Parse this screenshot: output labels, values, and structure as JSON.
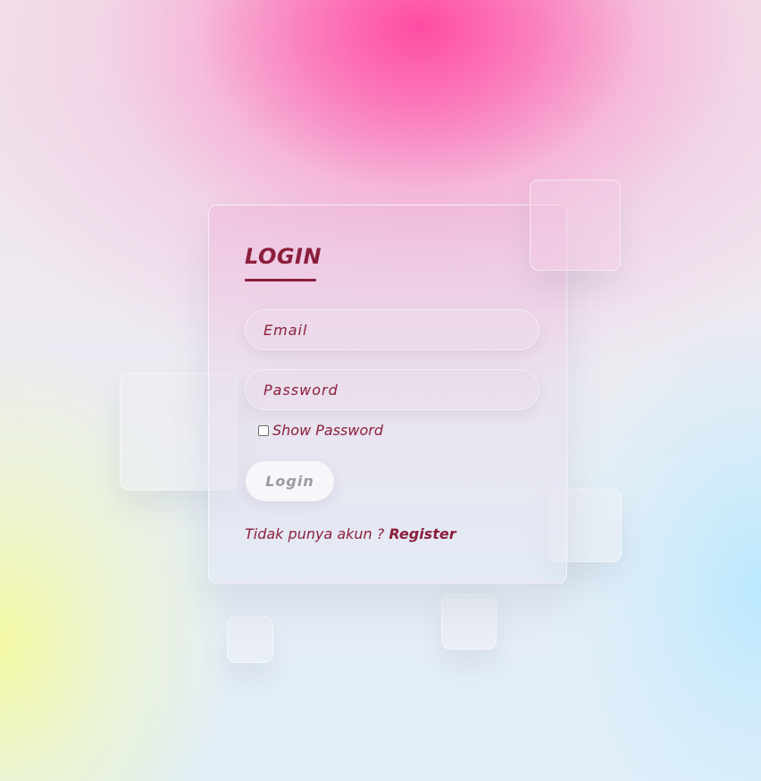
{
  "form": {
    "title": "LOGIN",
    "email_placeholder": "Email",
    "password_placeholder": "Password",
    "show_password_label": "Show Password",
    "show_password_checked": false,
    "login_button_label": "Login",
    "no_account_text": "Tidak punya akun ?",
    "register_link_label": "Register"
  },
  "colors": {
    "accent": "#8c1f3c",
    "button_text": "#9b9b9f",
    "bg_pink": "#ff46a0",
    "bg_yellow": "#f5faa0",
    "bg_blue": "#b9e8ff"
  }
}
